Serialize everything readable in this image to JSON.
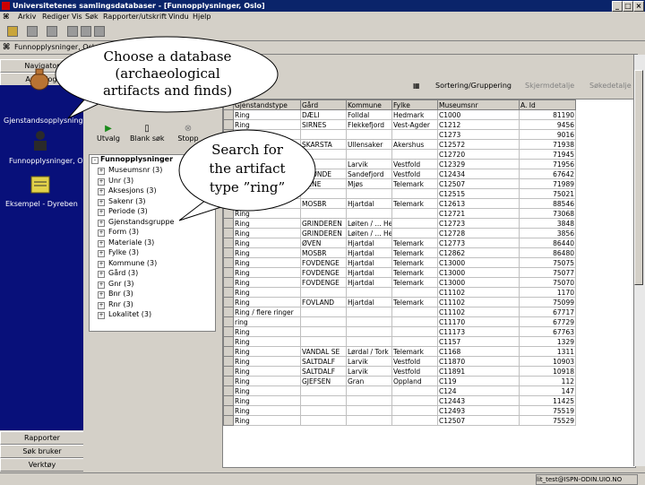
{
  "window": {
    "title": "Universitetenes samlingsdatabaser - [Funnopplysninger, Oslo]",
    "min": "_",
    "max": "□",
    "close": "×"
  },
  "menu": [
    "Arkiv",
    "Rediger",
    "Vis",
    "Søk",
    "Rapporter/utskrift",
    "Vindu",
    "Hjelp"
  ],
  "child_window": {
    "title": "Funnopplysninger, Oslo"
  },
  "leftbar": {
    "top_buttons": [
      "Navigator",
      "Arkeologi"
    ],
    "icons": [
      {
        "icon": "pot-icon",
        "label": "Gjenstandsopplysninger"
      },
      {
        "icon": "person-icon",
        "label": "Funnopplysninger, Oslo"
      },
      {
        "icon": "folder-icon",
        "label": "Eksempel - Dyreben"
      }
    ],
    "bottom_buttons": [
      "Rapporter",
      "Søk bruker",
      "Verktøy"
    ]
  },
  "middle": {
    "actions": [
      {
        "icon": "arrow-icon",
        "label": "Utvalg"
      },
      {
        "icon": "page-icon",
        "label": "Blank søk"
      },
      {
        "icon": "stop-icon",
        "label": "Stopp"
      }
    ],
    "tree_header": "Funnopplysninger",
    "tree_items": [
      "Museumsnr (3)",
      "Unr (3)",
      "Aksesjons (3)",
      "Sakenr (3)",
      "Periode (3)",
      "Gjenstandsgruppe",
      "Form (3)",
      "Materiale (3)",
      "Fylke (3)",
      "Kommune (3)",
      "Gård (3)",
      "Gnr (3)",
      "Bnr (3)",
      "Rnr (3)",
      "Lokalitet (3)"
    ]
  },
  "right_toolbar": {
    "buttons": [
      {
        "label": "Sortering/Gruppering",
        "enabled": true
      },
      {
        "label": "Skjermdetalje",
        "enabled": false
      },
      {
        "label": "Søkedetalje",
        "enabled": false
      }
    ]
  },
  "grid": {
    "columns": [
      "Gjenstandstype",
      "Gård",
      "Kommune",
      "Fylke",
      "Museumsnr",
      "A. Id"
    ],
    "rows": [
      [
        "Ring",
        "DÆLI",
        "Folldal",
        "Hedmark",
        "C1000",
        "81190"
      ],
      [
        "Ring",
        "SIRNES",
        "Flekkefjord",
        "Vest-Agder",
        "C1212",
        "9456"
      ],
      [
        "Ring",
        "",
        "",
        "",
        "C1273",
        "9016"
      ],
      [
        "Ring",
        "SKARSTA",
        "Ullensaker",
        "Akershus",
        "C12572",
        "71938"
      ],
      [
        "Ring",
        "",
        "",
        "",
        "C12720",
        "71945"
      ],
      [
        "Ring",
        "",
        "Larvik",
        "Vestfold",
        "C12329",
        "71956"
      ],
      [
        "Ring",
        "GRØNDE",
        "Sandefjord",
        "Vestfold",
        "C12434",
        "67642"
      ],
      [
        "Ring",
        "LIENE",
        "Mjøs",
        "Telemark",
        "C12507",
        "71989"
      ],
      [
        "Ring",
        "",
        "",
        "",
        "C12515",
        "75021"
      ],
      [
        "Ring",
        "MOSBR",
        "Hjartdal",
        "Telemark",
        "C12613",
        "88546"
      ],
      [
        "Ring",
        "",
        "",
        "",
        "C12721",
        "73068"
      ],
      [
        "Ring",
        "GRINDEREN",
        "Løiten / ... Hedmark",
        "",
        "C12723",
        "3848"
      ],
      [
        "Ring",
        "GRINDEREN",
        "Løiten / ... Hedmark",
        "",
        "C12728",
        "3856"
      ],
      [
        "Ring",
        "ØVEN",
        "Hjartdal",
        "Telemark",
        "C12773",
        "86440"
      ],
      [
        "Ring",
        "MOSBR",
        "Hjartdal",
        "Telemark",
        "C12862",
        "86480"
      ],
      [
        "Ring",
        "FOVDENGE",
        "Hjartdal",
        "Telemark",
        "C13000",
        "75075"
      ],
      [
        "Ring",
        "FOVDENGE",
        "Hjartdal",
        "Telemark",
        "C13000",
        "75077"
      ],
      [
        "Ring",
        "FOVDENGE",
        "Hjartdal",
        "Telemark",
        "C13000",
        "75070"
      ],
      [
        "Ring",
        "",
        "",
        "",
        "C11102",
        "1170"
      ],
      [
        "Ring",
        "FOVLAND",
        "Hjartdal",
        "Telemark",
        "C11102",
        "75099"
      ],
      [
        "Ring / flere ringer",
        "",
        "",
        "",
        "C11102",
        "67717"
      ],
      [
        "ring",
        "",
        "",
        "",
        "C11170",
        "67729"
      ],
      [
        "Ring",
        "",
        "",
        "",
        "C11173",
        "67763"
      ],
      [
        "Ring",
        "",
        "",
        "",
        "C1157",
        "1329"
      ],
      [
        "Ring",
        "VANDAL SE",
        "Lørdal / Tork",
        "Telemark",
        "C1168",
        "1311"
      ],
      [
        "Ring",
        "SALTDALF",
        "Larvik",
        "Vestfold",
        "C11870",
        "10903"
      ],
      [
        "Ring",
        "SALTDALF",
        "Larvik",
        "Vestfold",
        "C11891",
        "10918"
      ],
      [
        "Ring",
        "GJEFSEN",
        "Gran",
        "Oppland",
        "C119",
        "112"
      ],
      [
        "Ring",
        "",
        "",
        "",
        "C124",
        "147"
      ],
      [
        "Ring",
        "",
        "",
        "",
        "C12443",
        "11425"
      ],
      [
        "Ring",
        "",
        "",
        "",
        "C12493",
        "75519"
      ],
      [
        "Ring",
        "",
        "",
        "",
        "C12507",
        "75529"
      ]
    ]
  },
  "status": {
    "text": "lit_test@ISPN-ODIN.UIO.NO"
  },
  "callouts": [
    {
      "text_lines": [
        "Choose a database",
        "(archaeological",
        "artifacts and finds)"
      ]
    },
    {
      "text_lines": [
        "Search for",
        "the artifact",
        "type ”ring”"
      ]
    }
  ]
}
